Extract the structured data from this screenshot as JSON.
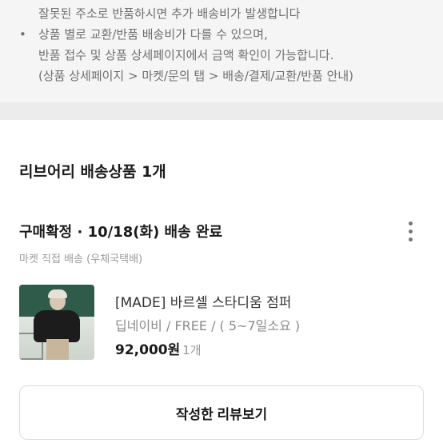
{
  "notice": {
    "line1": "잘못된 주소로 반품하시면 추가 배송비가 발생합니다",
    "bullet": "•",
    "line2": "상품 별로 교환/반품 배송비가 다를 수 있으며,",
    "line3": "반품 접수 및 상품 상세페이지에서 금액 확인이 가능합니다.",
    "line4": "(상품 상세페이지 > 마켓/문의 탭 > 배송/결제/교환/반품 안내)"
  },
  "section": {
    "title": "리브어리 배송상품 1개"
  },
  "order": {
    "status": "구매확정 · 10/18(화) 배송 완료",
    "shipping_method": "마켓 직접 배송 (우체국택배)",
    "more_icon": "more-vertical-icon"
  },
  "product": {
    "name": "[MADE] 바르셀 스타디움 점퍼",
    "option": "딥네이비 / FREE / ( 5~7일소요 )",
    "price": "92,000원",
    "quantity": "1개"
  },
  "actions": {
    "review_label": "작성한 리뷰보기"
  }
}
